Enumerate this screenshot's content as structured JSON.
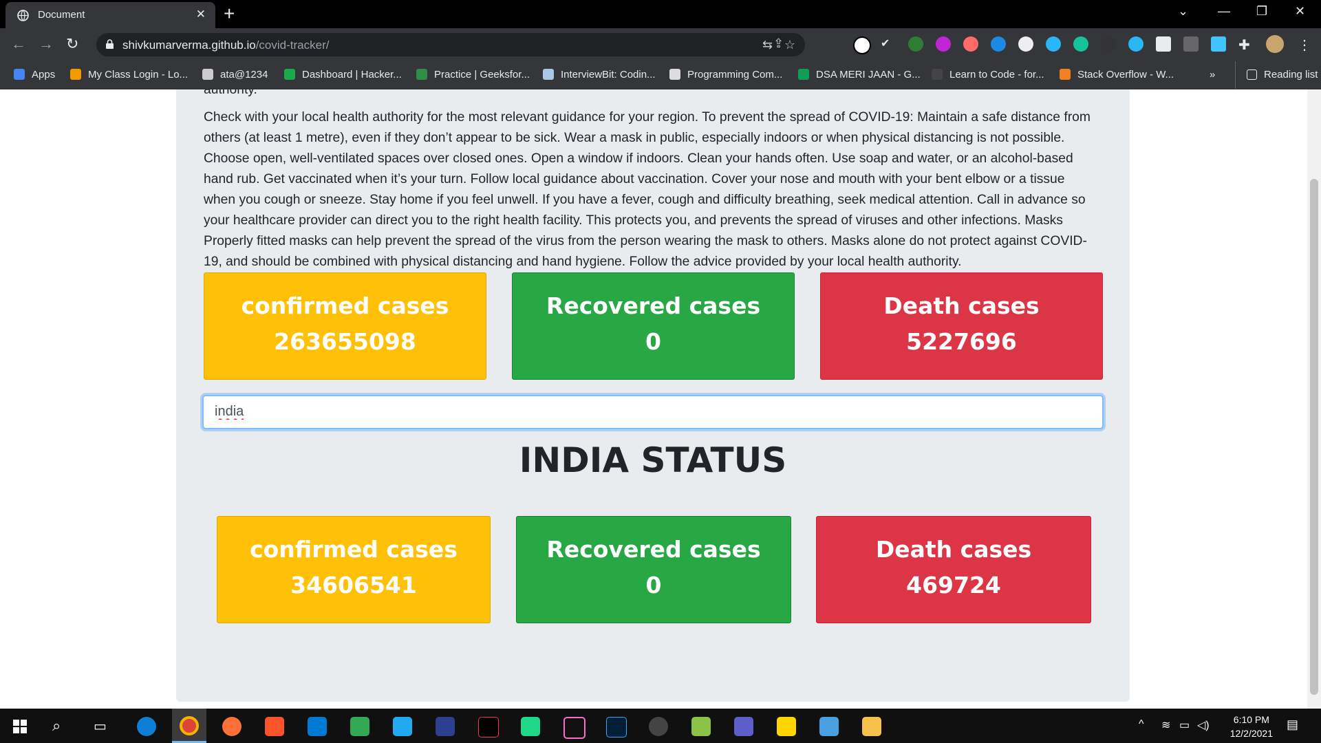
{
  "browser": {
    "tab_title": "Document",
    "url_domain": "shivkumarverma.github.io",
    "url_path": "/covid-tracker/",
    "bookmarks": [
      {
        "label": "Apps",
        "color": "#4285f4"
      },
      {
        "label": "My Class Login - Lo...",
        "color": "#f29900"
      },
      {
        "label": "ata@1234",
        "color": "#cccccc"
      },
      {
        "label": "Dashboard | Hacker...",
        "color": "#1ba94c"
      },
      {
        "label": "Practice | Geeksfor...",
        "color": "#2f8d46"
      },
      {
        "label": "InterviewBit: Codin...",
        "color": "#a9c8e8"
      },
      {
        "label": "Programming Com...",
        "color": "#dddddd"
      },
      {
        "label": "DSA MERI JAAN - G...",
        "color": "#0f9d58"
      },
      {
        "label": "Learn to Code - for...",
        "color": "#444444"
      },
      {
        "label": "Stack Overflow - W...",
        "color": "#f48024"
      }
    ],
    "reading_list": "Reading list",
    "more": "»"
  },
  "page": {
    "intro_tail": "authority.",
    "guidance": "Check with your local health authority for the most relevant guidance for your region. To prevent the spread of COVID-19: Maintain a safe distance from others (at least 1 metre), even if they don’t appear to be sick. Wear a mask in public, especially indoors or when physical distancing is not possible. Choose open, well-ventilated spaces over closed ones. Open a window if indoors. Clean your hands often. Use soap and water, or an alcohol-based hand rub. Get vaccinated when it’s your turn. Follow local guidance about vaccination. Cover your nose and mouth with your bent elbow or a tissue when you cough or sneeze. Stay home if you feel unwell. If you have a fever, cough and difficulty breathing, seek medical attention. Call in advance so your healthcare provider can direct you to the right health facility. This protects you, and prevents the spread of viruses and other infections. Masks Properly fitted masks can help prevent the spread of the virus from the person wearing the mask to others. Masks alone do not protect against COVID-19, and should be combined with physical distancing and hand hygiene. Follow the advice provided by your local health authority.",
    "global": {
      "confirmed_label": "confirmed cases",
      "confirmed_value": "263655098",
      "recovered_label": "Recovered cases",
      "recovered_value": "0",
      "death_label": "Death cases",
      "death_value": "5227696"
    },
    "search_value": "india",
    "country_title": "INDIA STATUS",
    "country": {
      "confirmed_label": "confirmed cases",
      "confirmed_value": "34606541",
      "recovered_label": "Recovered cases",
      "recovered_value": "0",
      "death_label": "Death cases",
      "death_value": "469724"
    }
  },
  "taskbar": {
    "time": "6:10 PM",
    "date": "12/2/2021"
  },
  "colors": {
    "confirmed": "#ffc107",
    "recovered": "#28a745",
    "death": "#dc3545"
  }
}
